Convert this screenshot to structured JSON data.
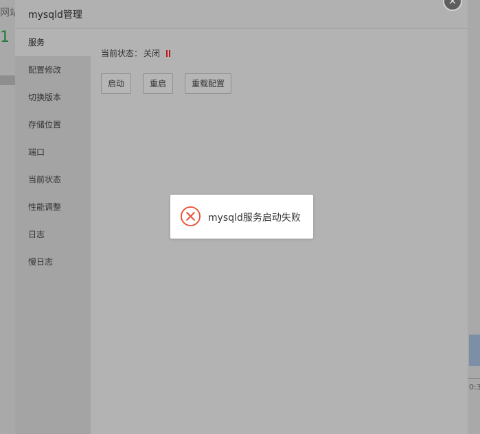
{
  "background": {
    "sites_label": "网站",
    "site_count": "1",
    "right_time": "0:3"
  },
  "dialog": {
    "title": "mysqld管理",
    "close_symbol": "×"
  },
  "sidebar": {
    "items": [
      {
        "label": "服务",
        "active": true
      },
      {
        "label": "配置修改"
      },
      {
        "label": "切换版本"
      },
      {
        "label": "存储位置"
      },
      {
        "label": "端口"
      },
      {
        "label": "当前状态"
      },
      {
        "label": "性能调整"
      },
      {
        "label": "日志"
      },
      {
        "label": "慢日志"
      }
    ]
  },
  "service": {
    "status_label": "当前状态：",
    "status_value": "关闭",
    "status_icon": "pause-icon",
    "status_color": "#b91c1c",
    "buttons": {
      "start": "启动",
      "restart": "重启",
      "reload": "重载配置"
    }
  },
  "toast": {
    "icon": "error-icon",
    "icon_color": "#e8533a",
    "message": "mysqld服务启动失败"
  }
}
